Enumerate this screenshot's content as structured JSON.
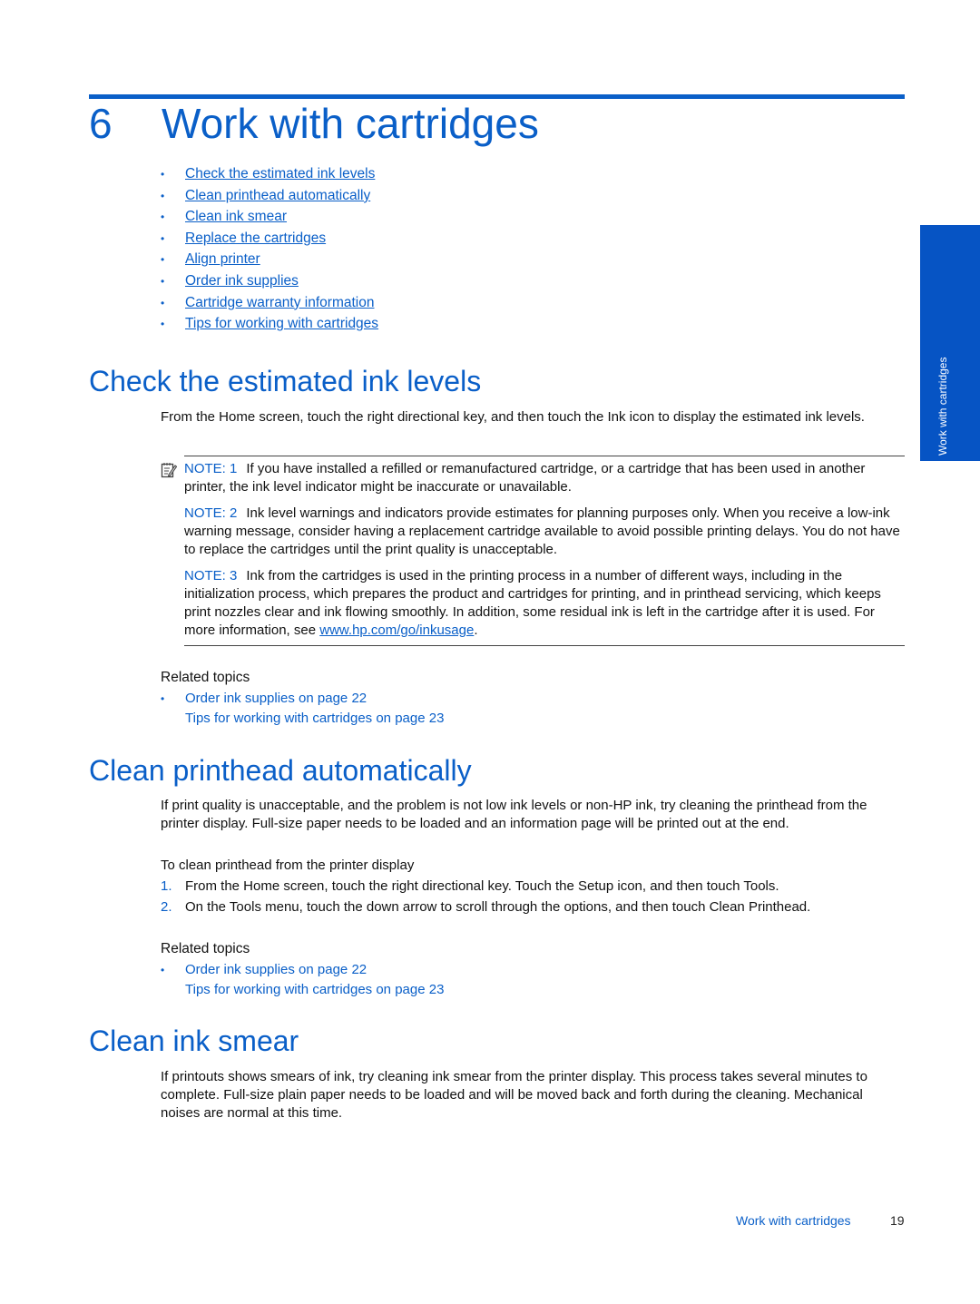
{
  "chapter": {
    "number": "6",
    "title": "Work with cartridges"
  },
  "toc": [
    "Check the estimated ink levels",
    "Clean printhead automatically",
    "Clean ink smear",
    "Replace the cartridges",
    "Align printer",
    "Order ink supplies",
    "Cartridge warranty information",
    "Tips for working with cartridges"
  ],
  "side_tab": "Work with cartridges",
  "section1": {
    "title": "Check the estimated ink levels",
    "intro": "From the Home screen, touch the right directional key, and then touch the Ink icon to display the estimated ink levels.",
    "notes": [
      {
        "label": "NOTE: 1",
        "text": "If you have installed a refilled or remanufactured cartridge, or a cartridge that has been used in another printer, the ink level indicator might be inaccurate or unavailable."
      },
      {
        "label": "NOTE: 2",
        "text": "Ink level warnings and indicators provide estimates for planning purposes only. When you receive a low-ink warning message, consider having a replacement cartridge available to avoid possible printing delays. You do not have to replace the cartridges until the print quality is unacceptable."
      },
      {
        "label": "NOTE: 3",
        "text": "Ink from the cartridges is used in the printing process in a number of different ways, including in the initialization process, which prepares the product and cartridges for printing, and in printhead servicing, which keeps print nozzles clear and ink flowing smoothly. In addition, some residual ink is left in the cartridge after it is used. For more information, see ",
        "link": "www.hp.com/go/inkusage",
        "after": "."
      }
    ],
    "related_label": "Related topics",
    "related": [
      "Order ink supplies on page 22",
      "Tips for working with cartridges on page 23"
    ]
  },
  "section2": {
    "title": "Clean printhead automatically",
    "intro": "If print quality is unacceptable, and the problem is not low ink levels or non-HP ink, try cleaning the printhead from the printer display. Full-size paper needs to be loaded and an information page will be printed out at the end.",
    "procedure_title": "To clean printhead from the printer display",
    "steps": [
      {
        "n": "1.",
        "text": "From the Home screen, touch the right directional key. Touch the Setup icon, and then touch Tools."
      },
      {
        "n": "2.",
        "text": "On the Tools menu, touch the down arrow to scroll through the options, and then touch Clean Printhead."
      }
    ],
    "related_label": "Related topics",
    "related": [
      "Order ink supplies on page 22",
      "Tips for working with cartridges on page 23"
    ]
  },
  "section3": {
    "title": "Clean ink smear",
    "intro": "If printouts shows smears of ink, try cleaning ink smear from the printer display. This process takes several minutes to complete. Full-size plain paper needs to be loaded and will be moved back and forth during the cleaning. Mechanical noises are normal at this time."
  },
  "footer": {
    "section": "Work with cartridges",
    "page": "19"
  },
  "colors": {
    "accent": "#0a5fc8",
    "side_tab": "#0654c4",
    "text": "#111111"
  }
}
